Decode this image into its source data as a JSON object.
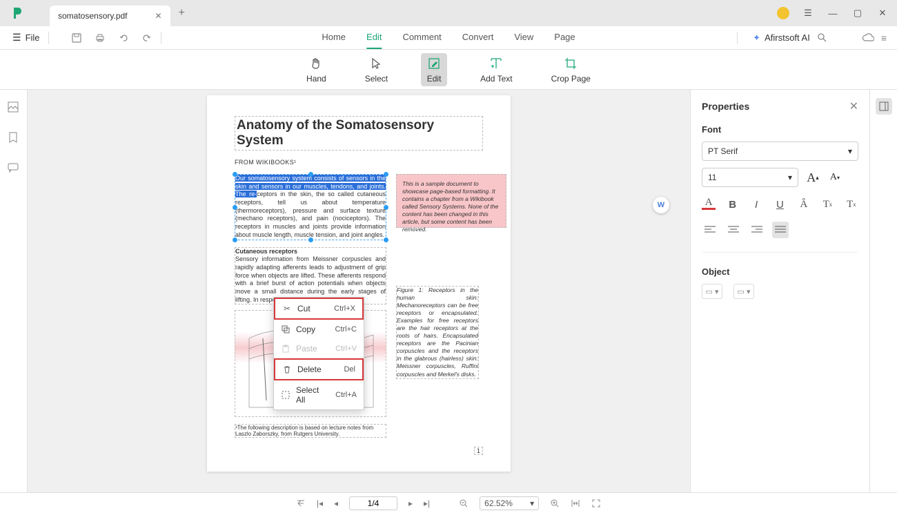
{
  "title_bar": {
    "tab_name": "somatosensory.pdf"
  },
  "menu_bar": {
    "file": "File",
    "tabs": [
      "Home",
      "Edit",
      "Comment",
      "Convert",
      "View",
      "Page"
    ],
    "active_tab": "Edit",
    "ai_label": "Afirstsoft AI"
  },
  "tool_bar": {
    "tools": [
      {
        "label": "Hand",
        "icon": "hand-icon"
      },
      {
        "label": "Select",
        "icon": "cursor-icon"
      },
      {
        "label": "Edit",
        "icon": "edit-icon",
        "active": true
      },
      {
        "label": "Add Text",
        "icon": "add-text-icon"
      },
      {
        "label": "Crop Page",
        "icon": "crop-icon"
      }
    ]
  },
  "context_menu": {
    "items": [
      {
        "label": "Cut",
        "shortcut": "Ctrl+X",
        "highlight": true
      },
      {
        "label": "Copy",
        "shortcut": "Ctrl+C"
      },
      {
        "label": "Paste",
        "shortcut": "Ctrl+V",
        "disabled": true
      },
      {
        "label": "Delete",
        "shortcut": "Del",
        "highlight": true
      },
      {
        "label": "Select All",
        "shortcut": "Ctrl+A"
      }
    ]
  },
  "page_content": {
    "title": "Anatomy of the Somatosensory System",
    "subtitle": "From Wikibooks¹",
    "selected_text_hl": "Our somatosensory system consists of sensors in the skin and sensors in our muscles, tendons, and joints. The re-",
    "selected_text_rest": "ceptors in the skin, the so called cutaneous receptors, tell us about temperature (thermoreceptors), pressure and surface texture (mechano receptors), and pain (nociceptors). The receptors in muscles and joints provide information about muscle length, muscle tension, and joint angles.",
    "note_box": "This is a sample document to showcase page-based formatting. It contains a chapter from a Wikibook called Sensory Systems. None of the content has been changed in this article, but some content has been removed.",
    "cutaneous_head": "Cutaneous receptors",
    "cutaneous_body": "Sensory information from Meissner corpuscles and rapidly adapting afferents leads to adjustment of grip force when objects are lifted. These afferents respond with a brief burst of action potentials when objects move a small distance during the early stages of lifting. In response to",
    "figure_caption": "Figure 1: Receptors in the human skin: Mechanoreceptors can be free receptors or encapsulated. Examples for free receptors are the hair receptors at the roots of hairs. Encapsulated receptors are the Pacinian corpuscles and the receptors in the glabrous (hairless) skin: Meissner corpuscles, Ruffini corpuscles and Merkel's disks.",
    "footnote": "¹The following description is based on lecture notes from Laszlo Zaborszky, from Rutgers University.",
    "page_num": "1"
  },
  "properties": {
    "title": "Properties",
    "font_section": "Font",
    "font_family": "PT Serif",
    "font_size": "11",
    "object_section": "Object"
  },
  "status_bar": {
    "page_display": "1/4",
    "zoom": "62.52%"
  }
}
